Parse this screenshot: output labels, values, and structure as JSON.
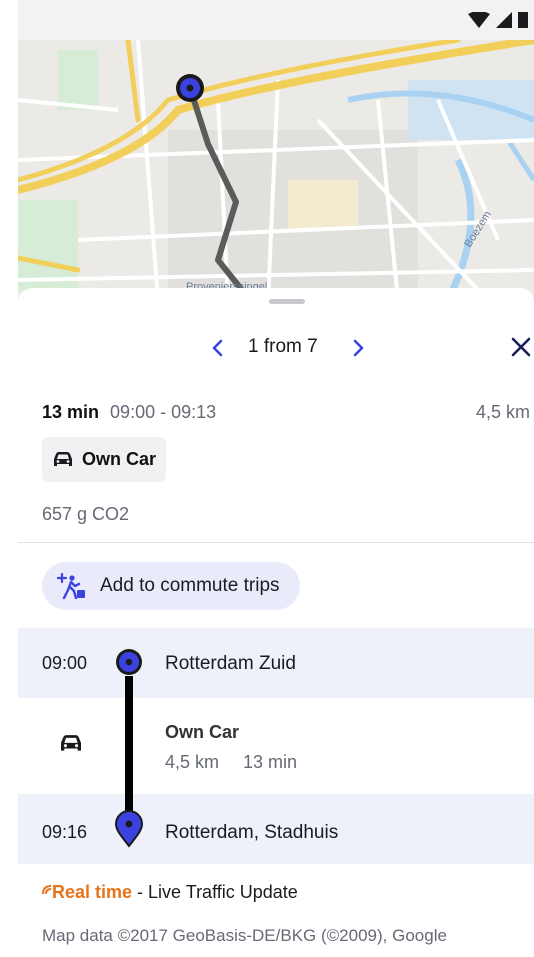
{
  "colors": {
    "accent": "#3b42e0",
    "route_line": "#5b5b5b",
    "marker_fill": "#3b42e0",
    "realtime": "#e8731a"
  },
  "map": {
    "street_label": "Provenierssingel",
    "water_label": "Boezem"
  },
  "pager": {
    "prev_icon": "chevron-left-icon",
    "counter": "1 from 7",
    "next_icon": "chevron-right-icon",
    "close_icon": "close-icon"
  },
  "summary": {
    "duration": "13 min",
    "times": "09:00 - 09:13",
    "distance": "4,5 km",
    "mode_icon": "car-icon",
    "mode": "Own Car",
    "co2": "657 g CO2"
  },
  "commute": {
    "icon": "commute-add-icon",
    "label": "Add to commute trips"
  },
  "itinerary": {
    "origin": {
      "time": "09:00",
      "place": "Rotterdam Zuid"
    },
    "leg": {
      "mode": "Own Car",
      "distance": "4,5 km",
      "duration": "13 min"
    },
    "destination": {
      "time": "09:16",
      "place": "Rotterdam, Stadhuis"
    }
  },
  "realtime": {
    "label": "Real time",
    "text": " - Live Traffic Update"
  },
  "footer": {
    "attribution": "Map data ©2017 GeoBasis-DE/BKG (©2009), Google"
  }
}
